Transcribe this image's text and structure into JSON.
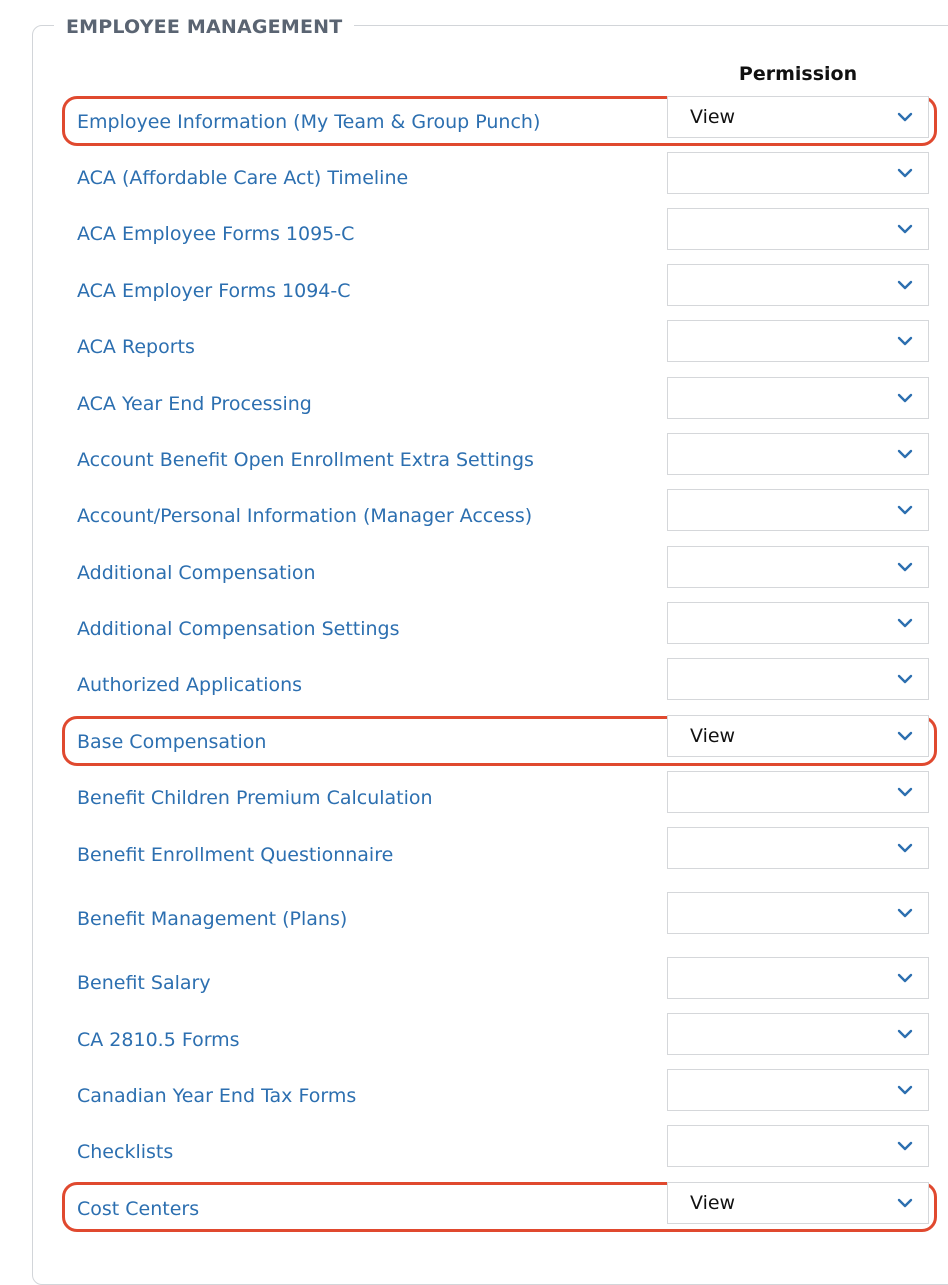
{
  "section": {
    "title": "EMPLOYEE MANAGEMENT",
    "column_header": "Permission"
  },
  "colors": {
    "link_text": "#2c6fb0",
    "highlight": "#e0492f",
    "chevron": "#2c6fb0"
  },
  "permissions": [
    {
      "label": "Employee Information (My Team & Group Punch)",
      "value": "View",
      "highlighted": true
    },
    {
      "label": "ACA (Affordable Care Act) Timeline",
      "value": ""
    },
    {
      "label": "ACA Employee Forms 1095-C",
      "value": ""
    },
    {
      "label": "ACA Employer Forms 1094-C",
      "value": ""
    },
    {
      "label": "ACA Reports",
      "value": ""
    },
    {
      "label": "ACA Year End Processing",
      "value": ""
    },
    {
      "label": "Account Benefit Open Enrollment Extra Settings",
      "value": ""
    },
    {
      "label": "Account/Personal Information (Manager Access)",
      "value": ""
    },
    {
      "label": "Additional Compensation",
      "value": ""
    },
    {
      "label": "Additional Compensation Settings",
      "value": ""
    },
    {
      "label": "Authorized Applications",
      "value": ""
    },
    {
      "label": "Base Compensation",
      "value": "View",
      "highlighted": true
    },
    {
      "label": "Benefit Children Premium Calculation",
      "value": ""
    },
    {
      "label": "Benefit Enrollment Questionnaire",
      "value": ""
    },
    {
      "label": "Benefit Management (Plans)",
      "value": ""
    },
    {
      "label": "Benefit Salary",
      "value": ""
    },
    {
      "label": "CA 2810.5 Forms",
      "value": ""
    },
    {
      "label": "Canadian Year End Tax Forms",
      "value": ""
    },
    {
      "label": "Checklists",
      "value": ""
    },
    {
      "label": "Cost Centers",
      "value": "View",
      "highlighted": true
    }
  ]
}
